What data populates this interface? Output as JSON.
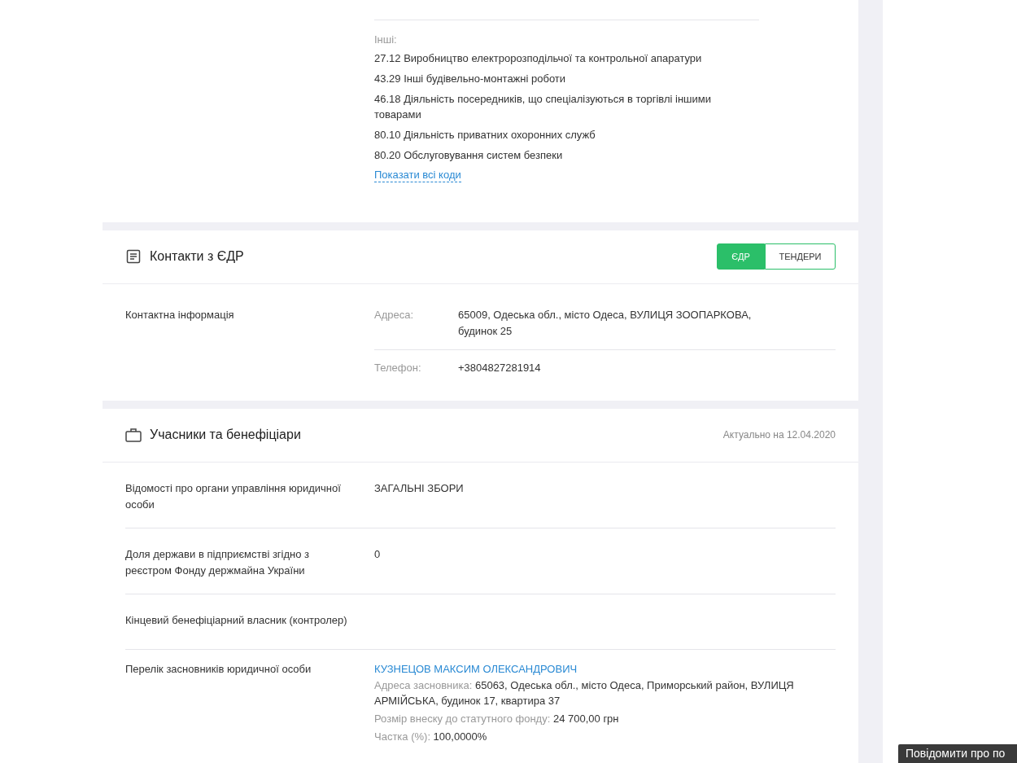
{
  "activities": {
    "other_label": "Інші:",
    "items": [
      "27.12 Виробництво електророзподільчої та контрольної апаратури",
      "43.29 Інші будівельно-монтажні роботи",
      "46.18 Діяльність посередників, що спеціалізуються в торгівлі іншими товарами",
      "80.10 Діяльність приватних охоронних служб",
      "80.20 Обслуговування систем безпеки"
    ],
    "show_all": "Показати всі коди"
  },
  "contacts": {
    "title": "Контакти з ЄДР",
    "tabs": [
      {
        "label": "ЄДР",
        "selected": true
      },
      {
        "label": "ТЕНДЕРИ",
        "selected": false
      }
    ],
    "row_label": "Контактна інформація",
    "fields": [
      {
        "label": "Адреса:",
        "value": "65009, Одеська обл., місто Одеса, ВУЛИЦЯ ЗООПАРКОВА, будинок 25"
      },
      {
        "label": "Телефон:",
        "value": "+3804827281914"
      }
    ]
  },
  "participants": {
    "title": "Учасники та бенефіціари",
    "actual": "Актуально на 12.04.2020",
    "rows": [
      {
        "label": "Відомості про органи управління юридичної особи",
        "value": "ЗАГАЛЬНІ ЗБОРИ"
      },
      {
        "label": "Доля держави в підприємстві згідно з реєстром Фонду держмайна України",
        "value": "0"
      },
      {
        "label": "Кінцевий бенефіціарний власник (контролер)"
      }
    ],
    "founders": {
      "label": "Перелік засновників юридичної особи",
      "name": "КУЗНЕЦОВ МАКСИМ ОЛЕКСАНДРОВИЧ",
      "details": [
        {
          "label": "Адреса засновника:",
          "value": "65063, Одеська обл., місто Одеса, Приморський район, ВУЛИЦЯ АРМІЙСЬКА, будинок 17, квартира 37"
        },
        {
          "label": "Розмір внеску до статутного фонду:",
          "value": "24 700,00 грн"
        },
        {
          "label": "Частка (%):",
          "value": "100,0000%"
        }
      ]
    }
  },
  "report_button": "Повідомити про по"
}
